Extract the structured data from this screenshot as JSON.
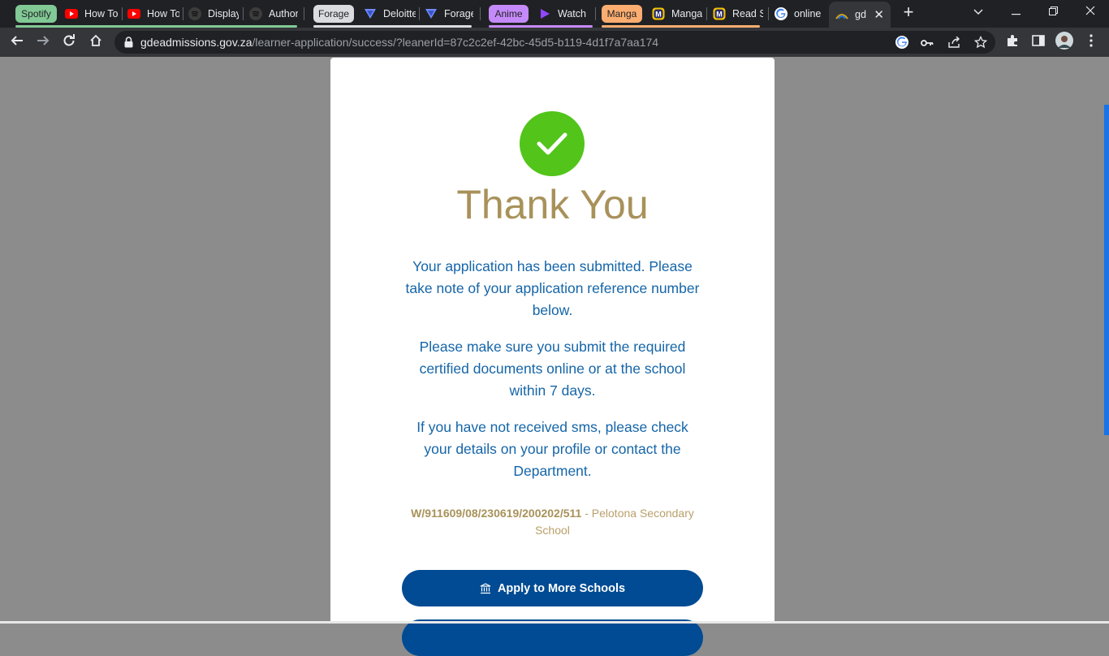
{
  "tab_groups": [
    {
      "label": "Spotify",
      "color": "#81c995"
    },
    {
      "label": "Forage",
      "color": "#dadce0"
    },
    {
      "label": "Anime",
      "color": "#c58af9"
    },
    {
      "label": "Manga",
      "color": "#fcad70"
    }
  ],
  "tabs": [
    {
      "title": "How To",
      "icon": "youtube-icon"
    },
    {
      "title": "How To",
      "icon": "youtube-icon"
    },
    {
      "title": "Display",
      "icon": "spotify-icon"
    },
    {
      "title": "Author",
      "icon": "spotify-icon"
    },
    {
      "title": "Deloitte",
      "icon": "forage-icon"
    },
    {
      "title": "Forage",
      "icon": "forage-icon"
    },
    {
      "title": "Watch",
      "icon": "play-icon"
    },
    {
      "title": "Manga",
      "icon": "manga-icon"
    },
    {
      "title": "Read S",
      "icon": "manga-icon"
    },
    {
      "title": "online",
      "icon": "google-icon"
    },
    {
      "title": "gd",
      "icon": "gde-icon"
    }
  ],
  "address_bar": {
    "domain": "gdeadmissions.gov.za",
    "path": "/learner-application/success/?leanerId=87c2c2ef-42bc-45d5-b119-4d1f7a7aa174"
  },
  "page": {
    "title": "Thank You",
    "paragraphs": [
      "Your application has been submitted. Please take note of your application reference number below.",
      "Please make sure you submit the required certified documents online or at the school within 7 days.",
      "If you have not received sms, please check your details on your profile or contact the Department."
    ],
    "reference_number": "W/911609/08/230619/200202/511",
    "reference_separator": " - ",
    "school": "Pelotona Secondary School",
    "apply_button": "Apply to More Schools"
  },
  "colors": {
    "accent_blue": "#004b93",
    "success_green": "#52c41a",
    "gold": "#a8925a",
    "text_blue": "#1565a8"
  }
}
